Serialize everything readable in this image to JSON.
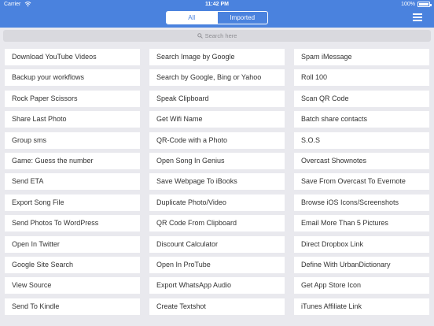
{
  "status": {
    "carrier": "Carrier",
    "time": "11:42 PM",
    "battery": "100%"
  },
  "tabs": {
    "all": "All",
    "imported": "Imported"
  },
  "search": {
    "placeholder": "Search here"
  },
  "columns": [
    [
      "Download YouTube Videos",
      "Backup your workflows",
      "Rock Paper Scissors",
      "Share Last Photo",
      "Group sms",
      "Game: Guess the number",
      "Send ETA",
      "Export Song File",
      "Send Photos To WordPress",
      "Open In Twitter",
      "Google Site Search",
      "View Source",
      "Send To Kindle"
    ],
    [
      "Search Image by Google",
      "Search by Google, Bing or Yahoo",
      "Speak Clipboard",
      "Get Wifi Name",
      "QR-Code with a Photo",
      "Open Song In Genius",
      "Save Webpage To iBooks",
      "Duplicate Photo/Video",
      "QR Code From Clipboard",
      "Discount Calculator",
      "Open In ProTube",
      "Export WhatsApp Audio",
      "Create Textshot"
    ],
    [
      "Spam iMessage",
      "Roll 100",
      "Scan QR Code",
      "Batch share contacts",
      "S.O.S",
      "Overcast Shownotes",
      "Save From Overcast To Evernote",
      "Browse iOS Icons/Screenshots",
      "Email More Than 5 Pictures",
      "Direct Dropbox Link",
      "Define With UrbanDictionary",
      "Get App Store Icon",
      "iTunes Affiliate Link"
    ]
  ]
}
